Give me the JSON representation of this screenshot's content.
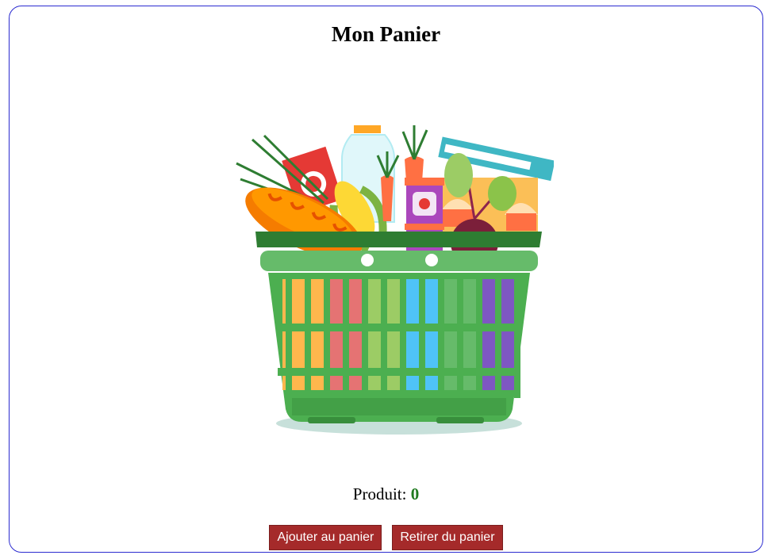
{
  "header": {
    "title": "Mon Panier"
  },
  "illustration": {
    "name": "grocery-basket",
    "basket_color": "#43a047"
  },
  "counter": {
    "label": "Produit:",
    "value": "0",
    "value_color": "#1f7a1f"
  },
  "actions": {
    "add_label": "Ajouter au panier",
    "remove_label": "Retirer du panier",
    "button_color": "#a52a2a"
  }
}
